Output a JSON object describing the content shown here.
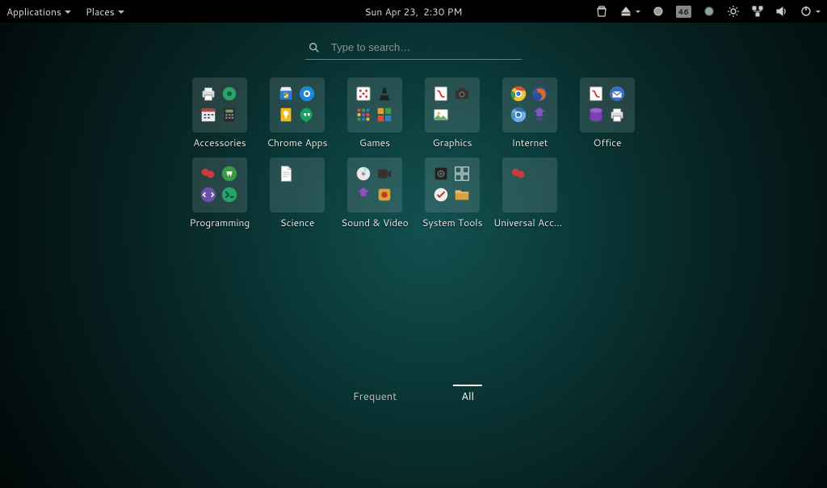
{
  "panel": {
    "apps_label": "Applications",
    "places_label": "Places",
    "date": "Sun Apr 23,",
    "time": "2:30 PM",
    "battery_badge": "46"
  },
  "search": {
    "placeholder": "Type to search…"
  },
  "categories": [
    {
      "label": "Accessories"
    },
    {
      "label": "Chrome Apps"
    },
    {
      "label": "Games"
    },
    {
      "label": "Graphics"
    },
    {
      "label": "Internet"
    },
    {
      "label": "Office"
    },
    {
      "label": "Programming"
    },
    {
      "label": "Science"
    },
    {
      "label": "Sound & Video"
    },
    {
      "label": "System Tools"
    },
    {
      "label": "Universal Access"
    }
  ],
  "tabs": {
    "frequent": "Frequent",
    "all": "All",
    "active": "all"
  }
}
